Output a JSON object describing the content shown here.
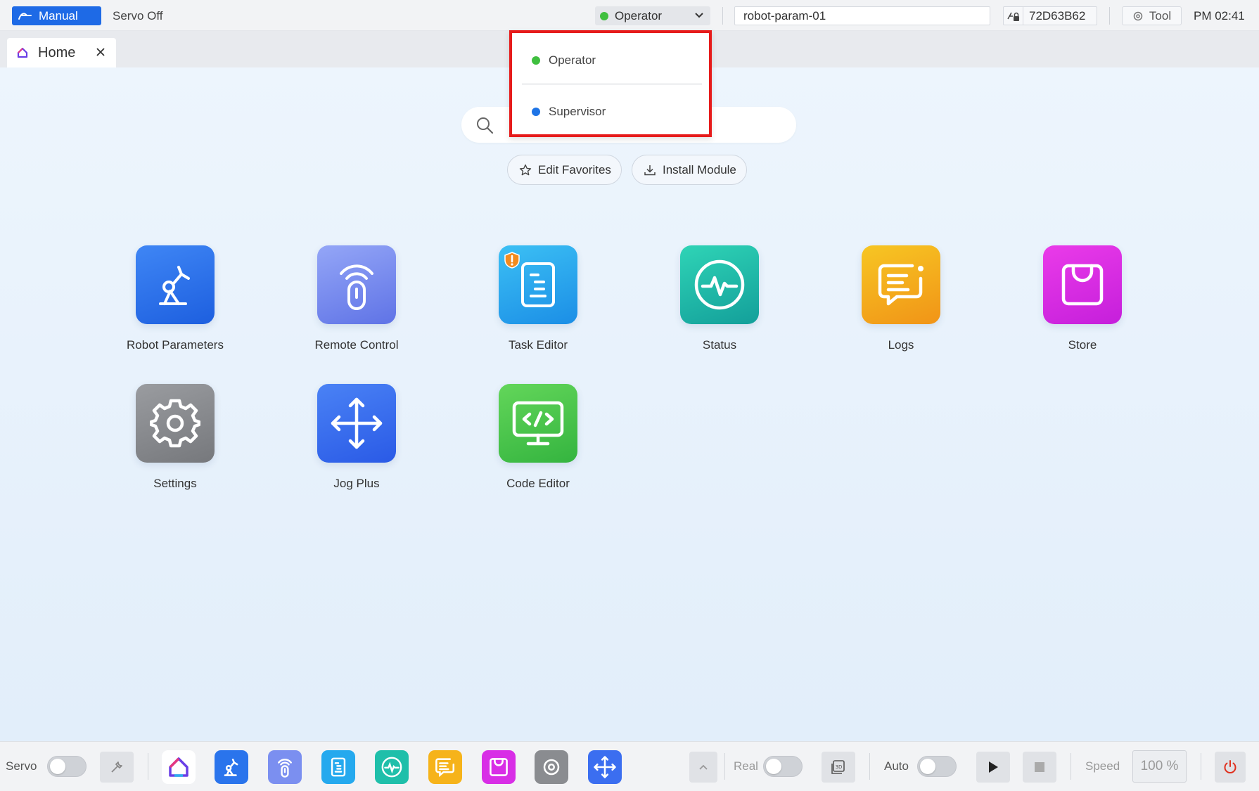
{
  "topbar": {
    "mode_label": "Manual",
    "servo_status": "Servo Off",
    "role": {
      "selected": "Operator",
      "dot_color": "#3fbf3f"
    },
    "robot_param_value": "robot-param-01",
    "serial": "72D63B62",
    "tool_label": "Tool",
    "clock": "PM 02:41"
  },
  "tabs": [
    {
      "label": "Home"
    }
  ],
  "search": {
    "placeholder": ""
  },
  "actions": {
    "edit_favorites": "Edit Favorites",
    "install_module": "Install Module"
  },
  "apps": [
    {
      "label": "Robot Parameters",
      "icon": "robot-arm-icon",
      "color": "#2a74ec"
    },
    {
      "label": "Remote Control",
      "icon": "remote-icon",
      "color": "#7b8ff0"
    },
    {
      "label": "Task Editor",
      "icon": "task-document-icon",
      "color": "#25a9ee",
      "warning": true
    },
    {
      "label": "Status",
      "icon": "pulse-icon",
      "color": "#1fbfaa"
    },
    {
      "label": "Logs",
      "icon": "chat-log-icon",
      "color": "#f6b31a"
    },
    {
      "label": "Store",
      "icon": "shopping-bag-icon",
      "color": "#d82ee6"
    },
    {
      "label": "Settings",
      "icon": "gear-icon",
      "color": "#8a8c90"
    },
    {
      "label": "Jog Plus",
      "icon": "move-arrows-icon",
      "color": "#3b6ef0"
    },
    {
      "label": "Code Editor",
      "icon": "code-monitor-icon",
      "color": "#4fc74a"
    }
  ],
  "role_dropdown": {
    "options": [
      {
        "label": "Operator",
        "color": "#3fbf3f"
      },
      {
        "label": "Supervisor",
        "color": "#1e74e6"
      }
    ]
  },
  "dock": {
    "servo_label": "Servo",
    "real_label": "Real",
    "auto_label": "Auto",
    "speed_label": "Speed",
    "speed_value": "100 %",
    "servo_on": false,
    "real_on": false,
    "auto_on": false
  }
}
